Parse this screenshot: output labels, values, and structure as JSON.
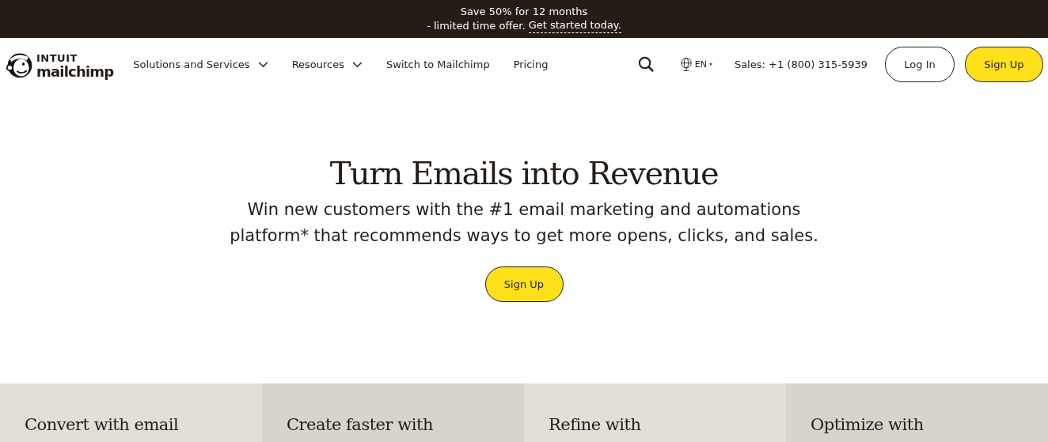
{
  "promo_banner": {
    "line_1": "Save 50% for 12 months",
    "line_2": "- limited time offer.",
    "link": "Get started today."
  },
  "header": {
    "logo_top": "INTUIT",
    "logo_bottom": "mailchimp",
    "nav": [
      {
        "label": "Solutions and Services",
        "has_menu": true
      },
      {
        "label": "Resources",
        "has_menu": true
      },
      {
        "label": "Switch to Mailchimp",
        "has_menu": false
      },
      {
        "label": "Pricing",
        "has_menu": false
      }
    ],
    "language": "EN",
    "sales": "Sales: +1 (800) 315-5939",
    "login": "Log In",
    "signup": "Sign Up"
  },
  "hero": {
    "title": "Turn Emails into Revenue",
    "subtitle": "Win new customers with the #1 email marketing and automations platform* that recommends ways to get more opens, clicks, and sales.",
    "button": "Sign Up"
  },
  "features": [
    {
      "title": "Convert with email"
    },
    {
      "title": "Create faster with"
    },
    {
      "title": "Refine with"
    },
    {
      "title": "Optimize with"
    }
  ]
}
